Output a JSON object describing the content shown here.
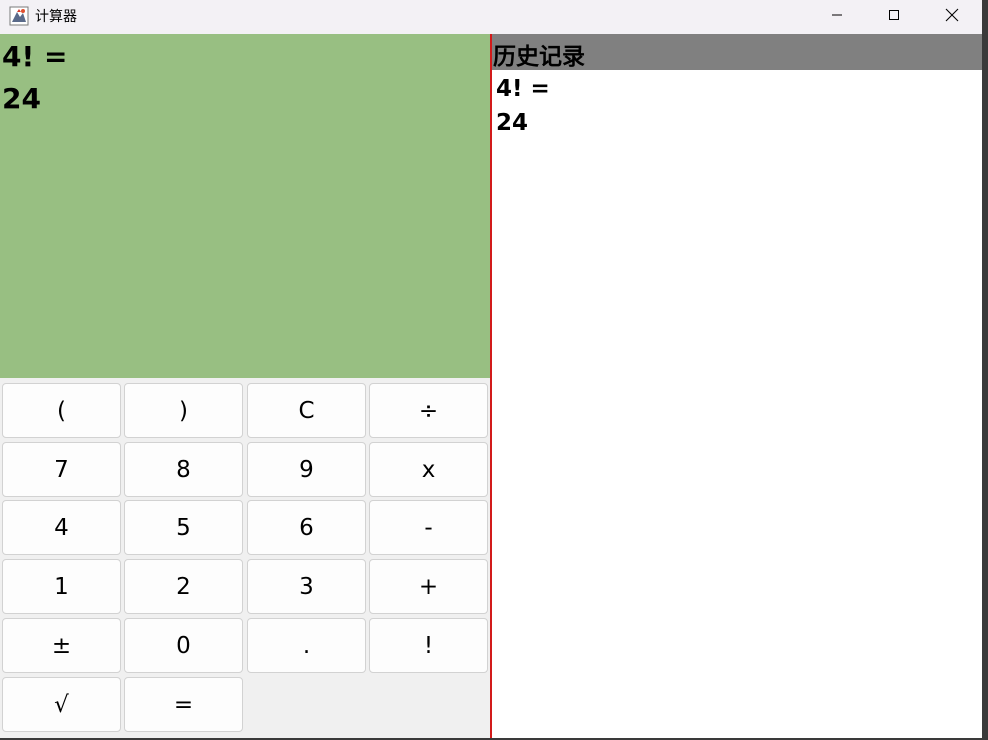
{
  "window": {
    "title": "计算器"
  },
  "display": {
    "expression": "4! =",
    "result": "24"
  },
  "history": {
    "title": "历史记录",
    "entries": [
      "4! =",
      "24"
    ]
  },
  "keypad": {
    "keys": [
      "(",
      ")",
      "C",
      "÷",
      "7",
      "8",
      "9",
      "x",
      "4",
      "5",
      "6",
      "-",
      "1",
      "2",
      "3",
      "+",
      "±",
      "0",
      ".",
      "!",
      "√",
      "="
    ]
  },
  "colors": {
    "display_bg": "#98bf82",
    "history_header_bg": "#808080",
    "divider": "#d21a1a"
  }
}
